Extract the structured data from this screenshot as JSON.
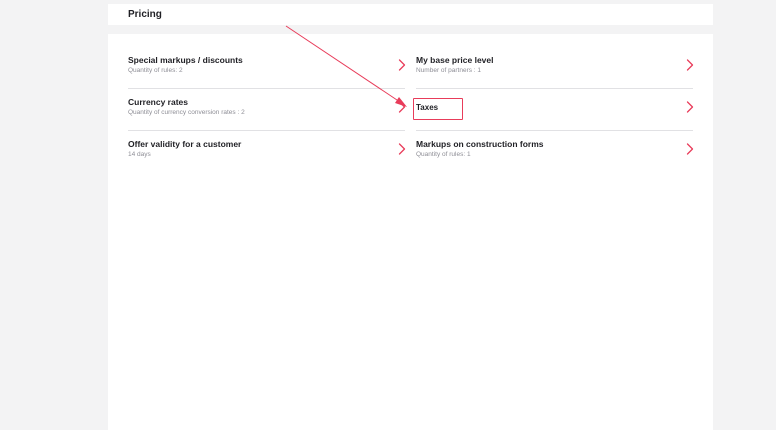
{
  "header": {
    "title": "Pricing"
  },
  "left_column": [
    {
      "title": "Special markups / discounts",
      "subtitle": "Quantity of rules: 2"
    },
    {
      "title": "Currency rates",
      "subtitle": "Quantity of currency conversion rates : 2"
    },
    {
      "title": "Offer validity for a customer",
      "subtitle": "14 days"
    }
  ],
  "right_column": [
    {
      "title": "My base price level",
      "subtitle": "Number of partners : 1"
    },
    {
      "title": "Taxes"
    },
    {
      "title": "Markups on construction forms",
      "subtitle": "Quantity of rules: 1"
    }
  ],
  "icons": {
    "chevron": "chevron-right-icon",
    "annotation_arrow": "annotation-arrow-icon"
  },
  "colors": {
    "accent": "#e83c5a",
    "background": "#f3f3f4",
    "card": "#ffffff",
    "title_text": "#1f1f24",
    "subtitle_text": "#8e8e96",
    "divider": "#e1e1e4"
  }
}
